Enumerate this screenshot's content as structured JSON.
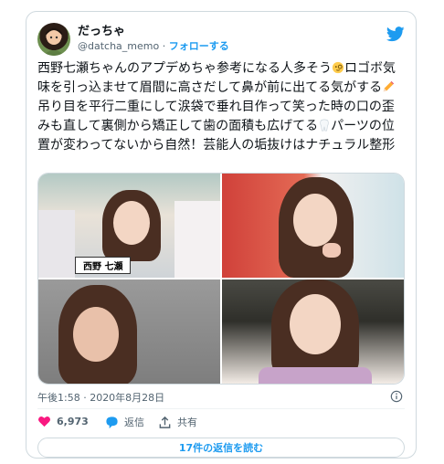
{
  "author": {
    "display_name": "だっちゃ",
    "handle": "@datcha_memo",
    "separator": "·",
    "follow_label": "フォローする"
  },
  "tweet": {
    "text_part1": "西野七瀬ちゃんのアプデめちゃ参考になる人多そう",
    "text_part2": "ロゴボ気味を引っ込ませて眉間に高さだして鼻が前に出てる気がする",
    "text_part3": "吊り目を平行二重にして涙袋で垂れ目作って笑った時の口の歪みも直して裏側から矯正して歯の面積も広げてる",
    "text_part4": "パーツの位置が変わってないから自然！芸能人の垢抜けはナチュラル整形",
    "emoji_1": "face-with-monocle",
    "emoji_2": "pencil",
    "emoji_3": "tooth"
  },
  "media": {
    "photo1_caption": "西野 七瀬",
    "photos": [
      "photo-1",
      "photo-2",
      "photo-3",
      "photo-4"
    ]
  },
  "meta": {
    "timestamp": "午後1:58 · 2020年8月28日"
  },
  "actions": {
    "likes": "6,973",
    "reply_label": "返信",
    "share_label": "共有"
  },
  "replies_button": "17件の返信を読む",
  "colors": {
    "accent": "#1d9bf0",
    "like": "#f91880",
    "text": "#0f1419",
    "muted": "#536471",
    "border": "#cfd9de"
  }
}
